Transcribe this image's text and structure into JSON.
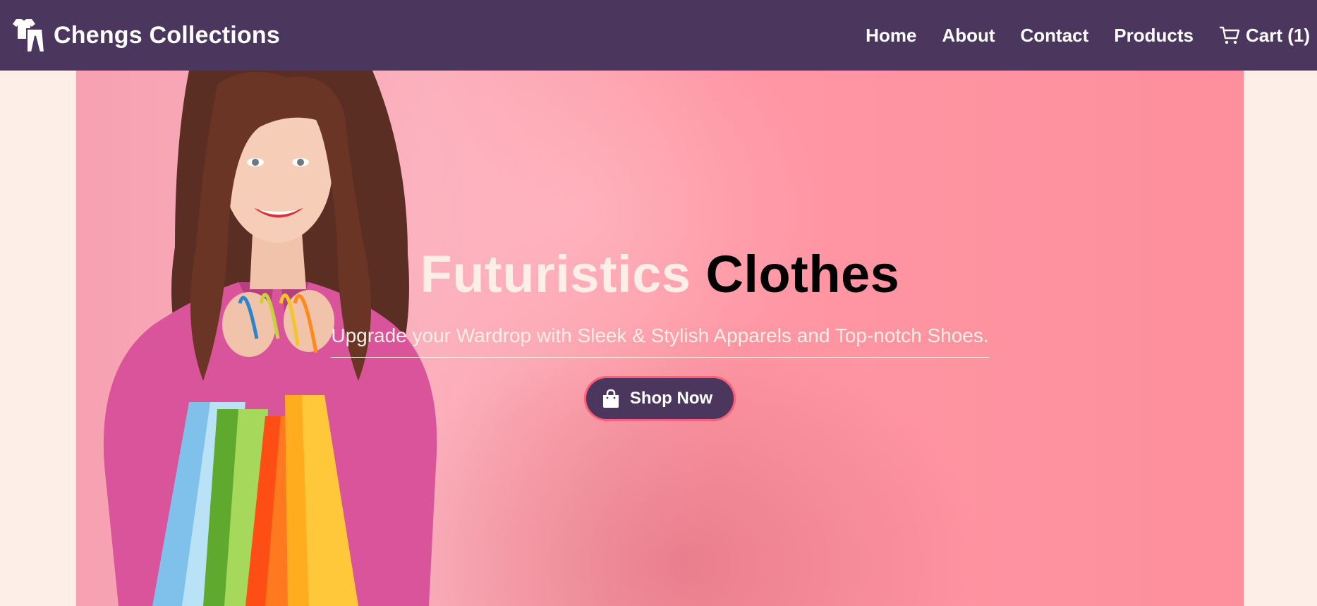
{
  "brand": {
    "name": "Chengs Collections",
    "icon": "clothes-icon"
  },
  "nav": {
    "items": [
      {
        "label": "Home"
      },
      {
        "label": "About"
      },
      {
        "label": "Contact"
      },
      {
        "label": "Products"
      }
    ],
    "cart_label": "Cart (1)",
    "cart_icon": "cart-icon"
  },
  "hero": {
    "title_part1": "Futuristics",
    "title_part2": "Clothes",
    "subtitle": "Upgrade your Wardrop with Sleek & Stylish Apparels and Top-notch Shoes.",
    "button_label": "Shop Now",
    "button_icon": "shopping-bag-icon",
    "image": "woman-holding-shopping-bags"
  },
  "colors": {
    "navbar": "#4b365e",
    "page_background": "#fdeee8",
    "hero_pink": "#ff97a4",
    "button_border": "#ff5f76"
  }
}
